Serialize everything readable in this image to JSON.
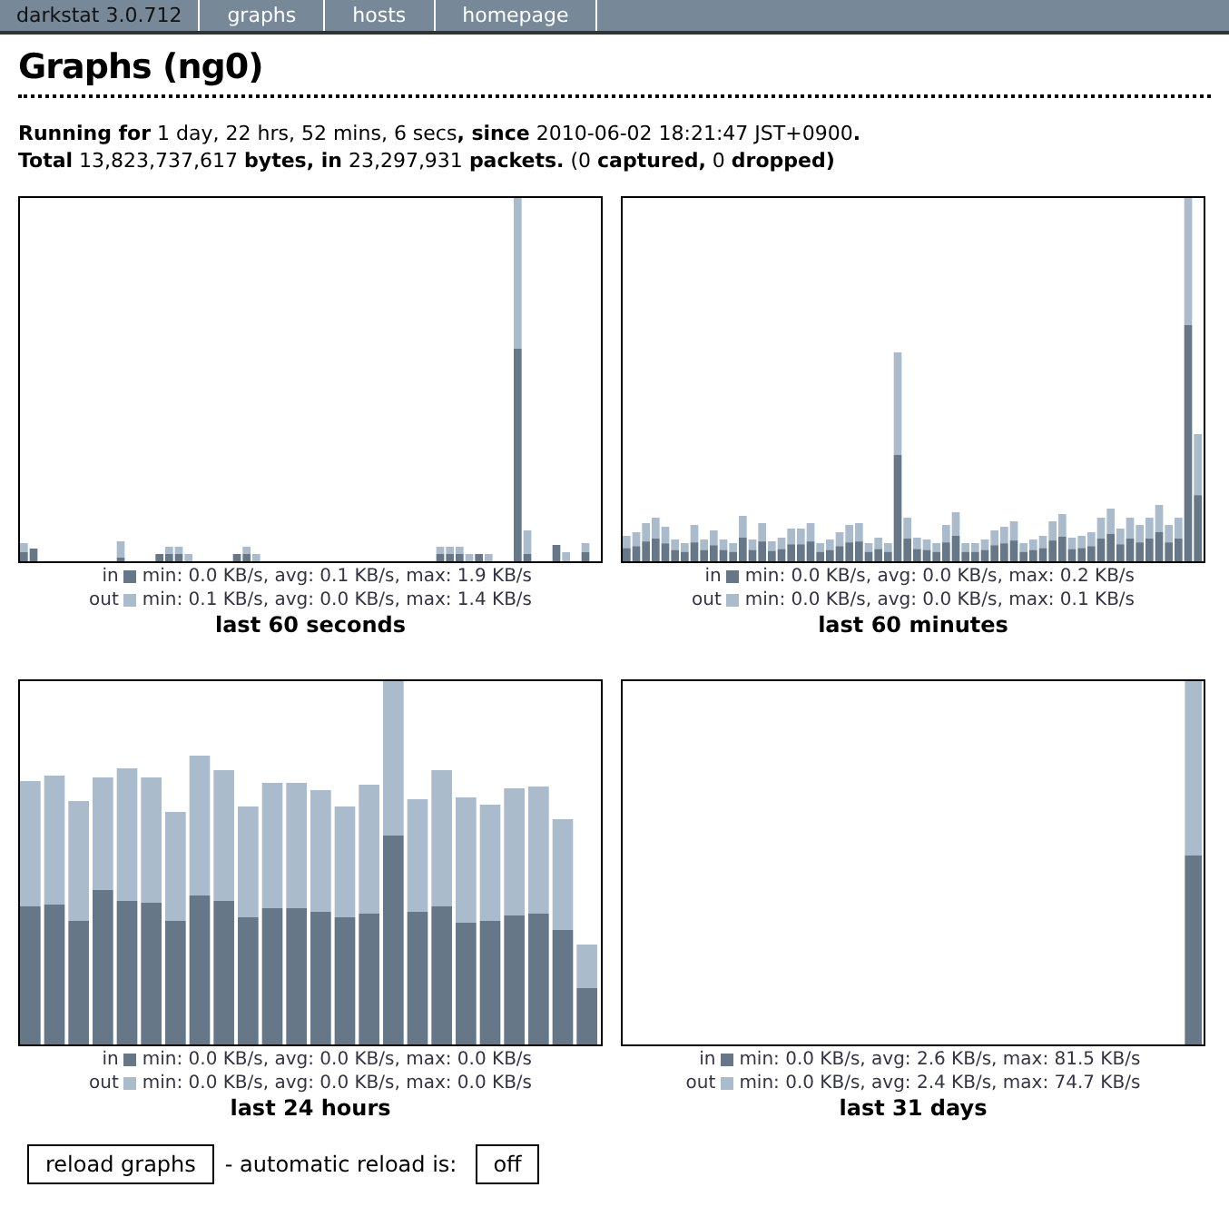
{
  "nav": [
    {
      "label": "darkstat 3.0.712",
      "kind": "brand"
    },
    {
      "label": "graphs",
      "kind": "link"
    },
    {
      "label": "hosts",
      "kind": "link"
    },
    {
      "label": "homepage",
      "kind": "link"
    }
  ],
  "title": "Graphs (ng0)",
  "summary": [
    "**Running for** 1 day, 22 hrs, 52 mins, 6 secs**, since** 2010-06-02 18:21:47 JST+0900**.**",
    "**Total** 13,823,737,617 **bytes, in** 23,297,931 **packets.** (0 **captured,** 0 **dropped)**"
  ],
  "graphs": [
    {
      "title": "last 60 seconds",
      "legend": [
        {
          "label": "in",
          "color": "#667788",
          "stats": "min: 0.0 KB/s, avg: 0.1 KB/s, max: 1.9 KB/s"
        },
        {
          "label": "out",
          "color": "#aabbcc",
          "stats": "min: 0.1 KB/s, avg: 0.0 KB/s, max: 1.4 KB/s"
        }
      ]
    },
    {
      "title": "last 60 minutes",
      "legend": [
        {
          "label": "in",
          "color": "#667788",
          "stats": "min: 0.0 KB/s, avg: 0.0 KB/s, max: 0.2 KB/s"
        },
        {
          "label": "out",
          "color": "#aabbcc",
          "stats": "min: 0.0 KB/s, avg: 0.0 KB/s, max: 0.1 KB/s"
        }
      ]
    },
    {
      "title": "last 24 hours",
      "legend": [
        {
          "label": "in",
          "color": "#667788",
          "stats": "min: 0.0 KB/s, avg: 0.0 KB/s, max: 0.0 KB/s"
        },
        {
          "label": "out",
          "color": "#aabbcc",
          "stats": "min: 0.0 KB/s, avg: 0.0 KB/s, max: 0.0 KB/s"
        }
      ]
    },
    {
      "title": "last 31 days",
      "legend": [
        {
          "label": "in",
          "color": "#667788",
          "stats": "min: 0.0 KB/s, avg: 2.6 KB/s, max: 81.5 KB/s"
        },
        {
          "label": "out",
          "color": "#aabbcc",
          "stats": "min: 0.0 KB/s, avg: 2.4 KB/s, max: 74.7 KB/s"
        }
      ]
    }
  ],
  "reload_button": "reload graphs",
  "auto_reload_label": "- automatic reload is:",
  "auto_reload_button": "off"
}
